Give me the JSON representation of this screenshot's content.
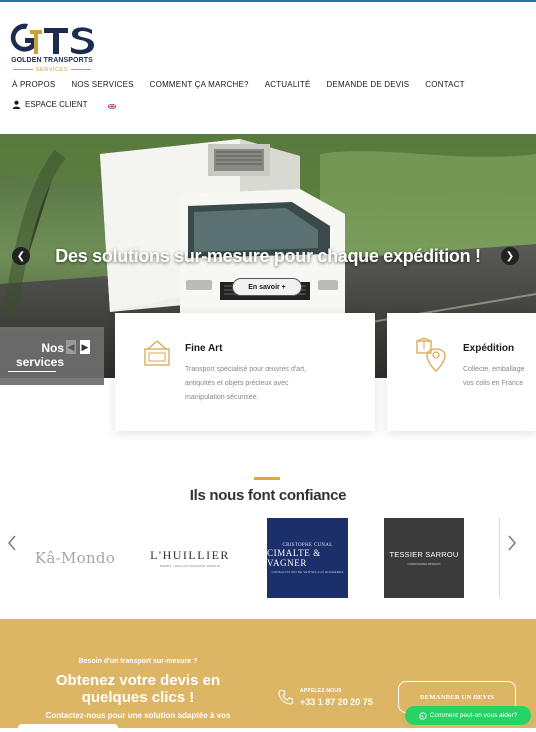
{
  "brand": {
    "logo_letters": "GTS",
    "name": "GOLDEN TRANSPORTS",
    "sub": "SERVICES",
    "colors": {
      "navy": "#1d2b4f",
      "gold": "#c9a13a",
      "accent": "#e0a933",
      "cta_bg": "#dcb565",
      "whatsapp": "#25d366"
    }
  },
  "nav": {
    "items": [
      {
        "label": "À PROPOS"
      },
      {
        "label": "NOS SERVICES"
      },
      {
        "label": "COMMENT ÇA MARCHE?"
      },
      {
        "label": "ACTUALITÉ"
      },
      {
        "label": "DEMANDE DE DEVIS"
      },
      {
        "label": "CONTACT"
      }
    ],
    "client_label": "ESPACE CLIENT",
    "client_icon": "user-icon",
    "language_icon": "uk-flag-icon"
  },
  "hero": {
    "title": "Des solutions sur-mesure pour chaque expédition !",
    "button": "En savoir +",
    "prev_icon": "chevron-left-icon",
    "next_icon": "chevron-right-icon"
  },
  "services": {
    "heading_line1": "Nos",
    "heading_line2": "services",
    "cards": [
      {
        "icon": "art-frame-icon",
        "title": "Fine Art",
        "desc_line1": "Transport spécialisé pour œuvres d'art,",
        "desc_line2": "antiquités et objets précieux avec",
        "desc_line3": "manipulation sécurisée."
      },
      {
        "icon": "parcel-map-icon",
        "title": "Expédition",
        "desc_line1": "Collecte, emballage",
        "desc_line2": "vos colis en France"
      }
    ]
  },
  "partners": {
    "heading": "Ils nous font confiance",
    "logos": [
      {
        "name": "Kâ-Mondo"
      },
      {
        "name": "L'HUILLIER",
        "tagline": "SARRT • PALLOX AVOCATS JUDICIA"
      },
      {
        "top": "CRISTOPHE CUNAL",
        "name": "CIMALTE & VAGNER",
        "tagline": "CONSULTATION DE VENTES AUX ENCHÈRES"
      },
      {
        "name": "TESSIER SARROU",
        "tagline": "COMMISSAIRES-PRISEURS"
      }
    ]
  },
  "cta": {
    "kicker": "Besoin d'un transport sur-mesure ?",
    "title_line1": "Obtenez votre devis en",
    "title_line2": "quelques clics !",
    "subtitle": "Contactez-nous pour une solution adaptée à vos",
    "phone_label": "APPELEZ-NOUS",
    "phone_number": "+33 1 87 20 20 75",
    "devis_button": "DEMANDER UN DEVIS"
  },
  "whatsapp": {
    "label": "Comment peut-on vous aider?"
  }
}
